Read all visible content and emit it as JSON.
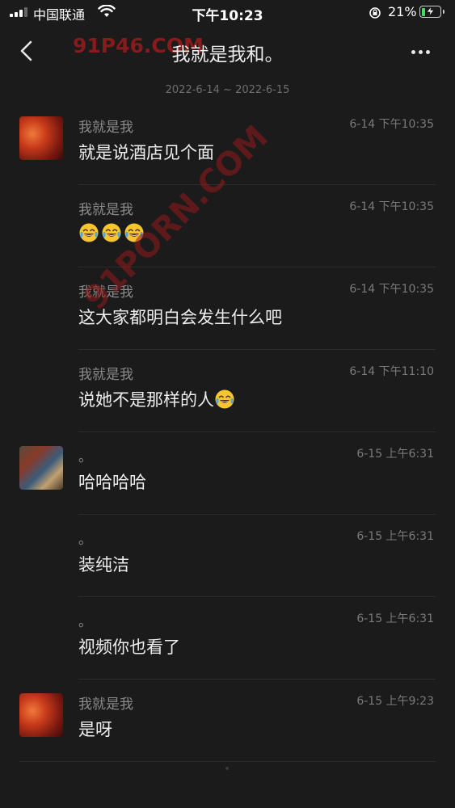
{
  "status_bar": {
    "carrier": "中国联通",
    "time": "下午10:23",
    "battery": "21%",
    "battery_level": 0.21,
    "icons": [
      "signal-icon",
      "wifi-icon",
      "rotation-lock-icon",
      "battery-charging-icon"
    ]
  },
  "nav": {
    "title": "我就是我和。",
    "watermark": "91P46.COM",
    "back_icon": "chevron-left-icon",
    "more_icon": "more-dots-icon"
  },
  "date_range": "2022-6-14 ~ 2022-6-15",
  "overlay_watermark": "91PORN.COM",
  "messages": [
    {
      "sender": "我就是我",
      "time": "6-14 下午10:35",
      "text": "就是说酒店见个面",
      "emoji_count": 0,
      "avatar": "red"
    },
    {
      "sender": "我就是我",
      "time": "6-14 下午10:35",
      "text": "",
      "emoji_count": 3,
      "avatar": ""
    },
    {
      "sender": "我就是我",
      "time": "6-14 下午10:35",
      "text": "这大家都明白会发生什么吧",
      "emoji_count": 0,
      "avatar": ""
    },
    {
      "sender": "我就是我",
      "time": "6-14 下午11:10",
      "text": "说她不是那样的人",
      "emoji_count": 1,
      "avatar": ""
    },
    {
      "sender": "。",
      "time": "6-15 上午6:31",
      "text": "哈哈哈哈",
      "emoji_count": 0,
      "avatar": "food"
    },
    {
      "sender": "。",
      "time": "6-15 上午6:31",
      "text": "装纯洁",
      "emoji_count": 0,
      "avatar": ""
    },
    {
      "sender": "。",
      "time": "6-15 上午6:31",
      "text": "视频你也看了",
      "emoji_count": 0,
      "avatar": ""
    },
    {
      "sender": "我就是我",
      "time": "6-15 上午9:23",
      "text": "是呀",
      "emoji_count": 0,
      "avatar": "red"
    }
  ],
  "emoji_name": "laughing-crying-emoji"
}
